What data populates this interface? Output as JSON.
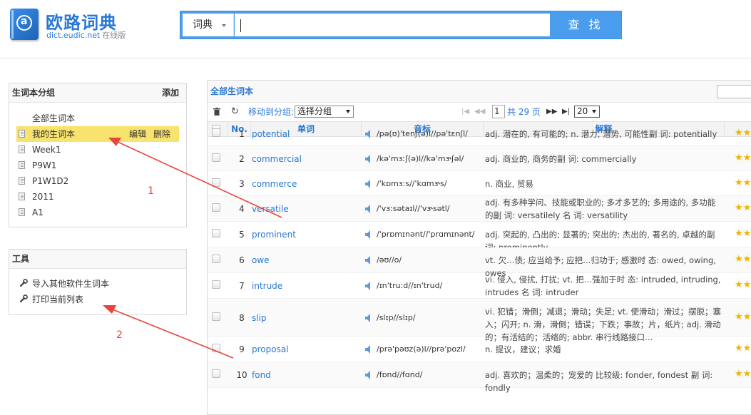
{
  "brand": {
    "title": "欧路词典",
    "domain": "dict.eudic.net",
    "tag": "在线版"
  },
  "search": {
    "dict_label": "词典",
    "button_label": "查 找",
    "value": ""
  },
  "groups_panel": {
    "title": "生词本分组",
    "add_label": "添加",
    "items": [
      {
        "label": "全部生词本",
        "icon": ""
      },
      {
        "label": "我的生词本",
        "icon": "document-icon",
        "edit": "编辑",
        "delete": "删除"
      },
      {
        "label": "Week1",
        "icon": "document-icon"
      },
      {
        "label": "P9W1",
        "icon": "document-icon"
      },
      {
        "label": "P1W1D2",
        "icon": "document-icon"
      },
      {
        "label": "2011",
        "icon": "document-icon"
      },
      {
        "label": "A1",
        "icon": "document-icon"
      }
    ]
  },
  "tools_panel": {
    "title": "工具",
    "items": [
      {
        "label": "导入其他软件生词本",
        "icon": "wrench-icon"
      },
      {
        "label": "打印当前列表",
        "icon": "wrench-icon"
      }
    ]
  },
  "main": {
    "title": "全部生词本",
    "toolbar": {
      "move_label": "移动到分组:",
      "group_select": "选择分组",
      "page_current": "1",
      "page_total": "共 29 页",
      "page_size": "20"
    },
    "columns": {
      "no": "No.",
      "word": "单词",
      "phonetic": "音标",
      "definition": "解释"
    },
    "rows": [
      {
        "no": "1",
        "word": "potential",
        "phonetic": "/pə(ʊ)'tenʃ(ə)l//pə'tɛnʃl/",
        "definition": "adj. 潜在的, 有可能的; n. 潜力, 潜势, 可能性副 词: potentially"
      },
      {
        "no": "2",
        "word": "commercial",
        "phonetic": "/kə'mɜːʃ(ə)l//kə'mɝʃəl/",
        "definition": "adj. 商业的, 商务的副 词: commercially"
      },
      {
        "no": "3",
        "word": "commerce",
        "phonetic": "/'kɒmɜːs//'kɑmɝs/",
        "definition": "n. 商业, 贸易"
      },
      {
        "no": "4",
        "word": "versatile",
        "phonetic": "/'vɜːsətaɪl//'vɝsətl/",
        "definition": "adj. 有多种学问、技能或职业的; 多才多艺的; 多用途的, 多功能的副 词: versatilely 名 词: versatility"
      },
      {
        "no": "5",
        "word": "prominent",
        "phonetic": "/'prɒmɪnənt//'prɑmɪnənt/",
        "definition": "adj. 突起的, 凸出的; 显著的; 突出的; 杰出的, 著名的, 卓越的副 词: prominently"
      },
      {
        "no": "6",
        "word": "owe",
        "phonetic": "/əʊ//o/",
        "definition": "vt. 欠…债; 应当给予; 应把…归功于; 感激时 态: owed, owing, owes"
      },
      {
        "no": "7",
        "word": "intrude",
        "phonetic": "/ɪn'truːd//ɪn'trud/",
        "definition": "vi. 侵入, 侵扰, 打扰; vt. 把…强加于时 态: intruded, intruding, intrudes 名 词: intruder"
      },
      {
        "no": "8",
        "word": "slip",
        "phonetic": "/slɪp//slɪp/",
        "definition": "vi. 犯错；滑倒；减退；滑动；失足; vt. 使滑动；滑过；摆脱；塞入；闪开; n. 滑，滑倒；错误；下跌；事故；片，纸片; adj. 滑动的；有活结的；活络的; abbr. 串行线路接口…"
      },
      {
        "no": "9",
        "word": "proposal",
        "phonetic": "/prə'pəʊz(ə)l//prə'pozl/",
        "definition": "n. 提议，建议；求婚"
      },
      {
        "no": "10",
        "word": "fond",
        "phonetic": "/fɒnd//fɑnd/",
        "definition": "adj. 喜欢的；温柔的；宠爱的 比较级: fonder, fondest 副 词: fondly"
      }
    ]
  },
  "annotations": {
    "label_1": "1",
    "label_2": "2",
    "color": "#e8453c"
  },
  "colors": {
    "brand": "#2a78d4",
    "search_bar": "#4a9ced",
    "selected": "#f7e36e",
    "star": "#f0b400"
  }
}
